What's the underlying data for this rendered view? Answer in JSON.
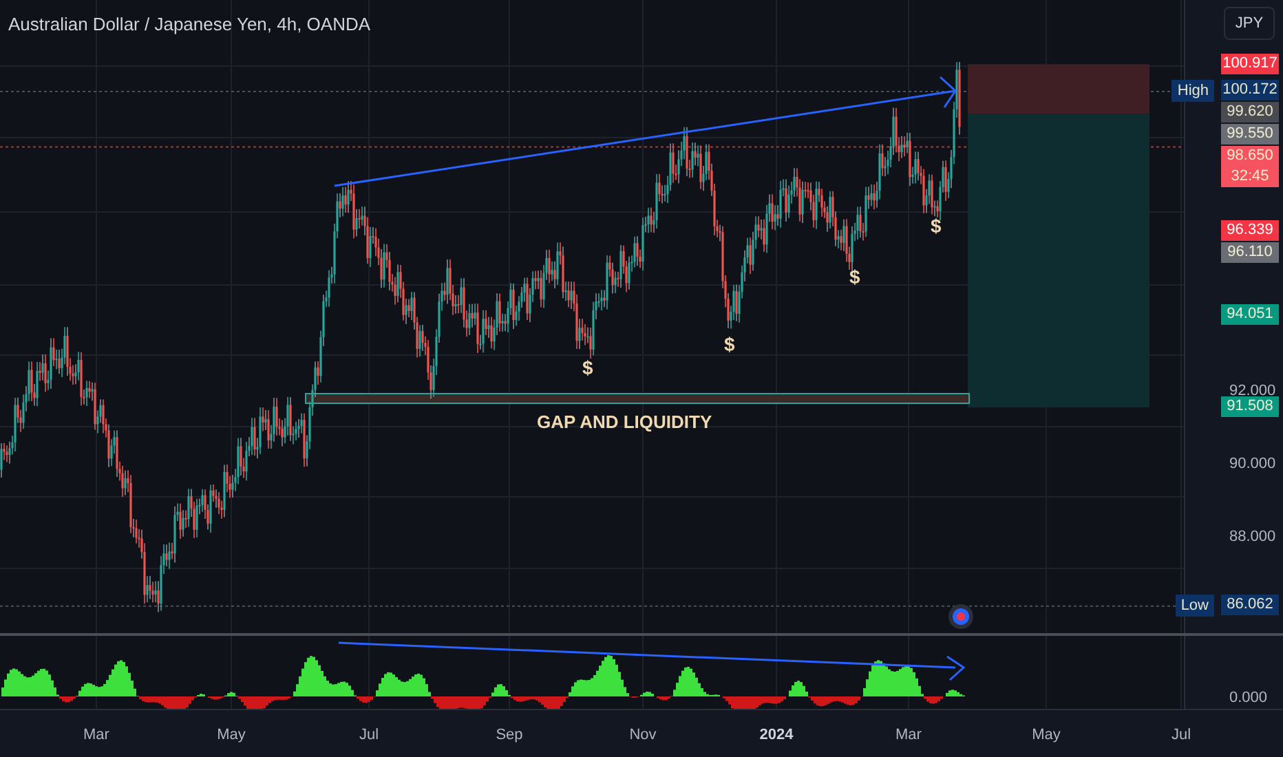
{
  "chart": {
    "title": "Australian Dollar / Japanese Yen, 4h, OANDA",
    "currency_button": "JPY",
    "annotation_text": "GAP AND LIQUIDITY",
    "markers": [
      "$",
      "$",
      "$",
      "$"
    ],
    "price_scale": {
      "ticks": [
        "92.000",
        "90.000",
        "88.000"
      ],
      "tags": [
        {
          "text": "100.917",
          "kind": "stop"
        },
        {
          "text": "100.172",
          "kind": "extreme",
          "label": "High"
        },
        {
          "text": "99.620",
          "kind": "dark"
        },
        {
          "text": "99.550",
          "kind": "gray"
        },
        {
          "text": "98.650",
          "kind": "last",
          "countdown": "32:45"
        },
        {
          "text": "96.339",
          "kind": "stop"
        },
        {
          "text": "96.110",
          "kind": "gray"
        },
        {
          "text": "94.051",
          "kind": "target"
        },
        {
          "text": "91.508",
          "kind": "target"
        },
        {
          "text": "86.062",
          "kind": "extreme",
          "label": "Low"
        }
      ]
    }
  },
  "indicator": {
    "tick": "0.000"
  },
  "time_axis": [
    {
      "text": "Mar",
      "kind": "month"
    },
    {
      "text": "May",
      "kind": "month"
    },
    {
      "text": "Jul",
      "kind": "month"
    },
    {
      "text": "Sep",
      "kind": "month"
    },
    {
      "text": "Nov",
      "kind": "month"
    },
    {
      "text": "2024",
      "kind": "year"
    },
    {
      "text": "Mar",
      "kind": "month"
    },
    {
      "text": "May",
      "kind": "month"
    },
    {
      "text": "Jul",
      "kind": "month"
    }
  ]
}
